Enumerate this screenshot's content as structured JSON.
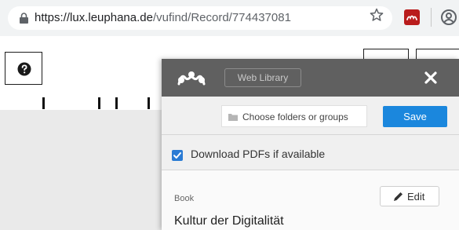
{
  "browser": {
    "url_host": "https://lux.leuphana.de",
    "url_path": "/vufind/Record/774437081",
    "icons": [
      "lock-icon",
      "star-icon",
      "mendeley-extension-icon",
      "profile-icon"
    ]
  },
  "page": {
    "help_icon": "question-circle-icon"
  },
  "popup": {
    "web_library_label": "Web Library",
    "folder_placeholder": "Choose folders or groups",
    "save_label": "Save",
    "download_label": "Download PDFs if available",
    "download_checked": true,
    "item_type": "Book",
    "edit_label": "Edit",
    "item_title": "Kultur der Digitalität"
  },
  "colors": {
    "header": "#606060",
    "save": "#1b87dd",
    "checkbox": "#2a7bd4",
    "extension": "#b91c1c",
    "accent": "#a62f31"
  }
}
